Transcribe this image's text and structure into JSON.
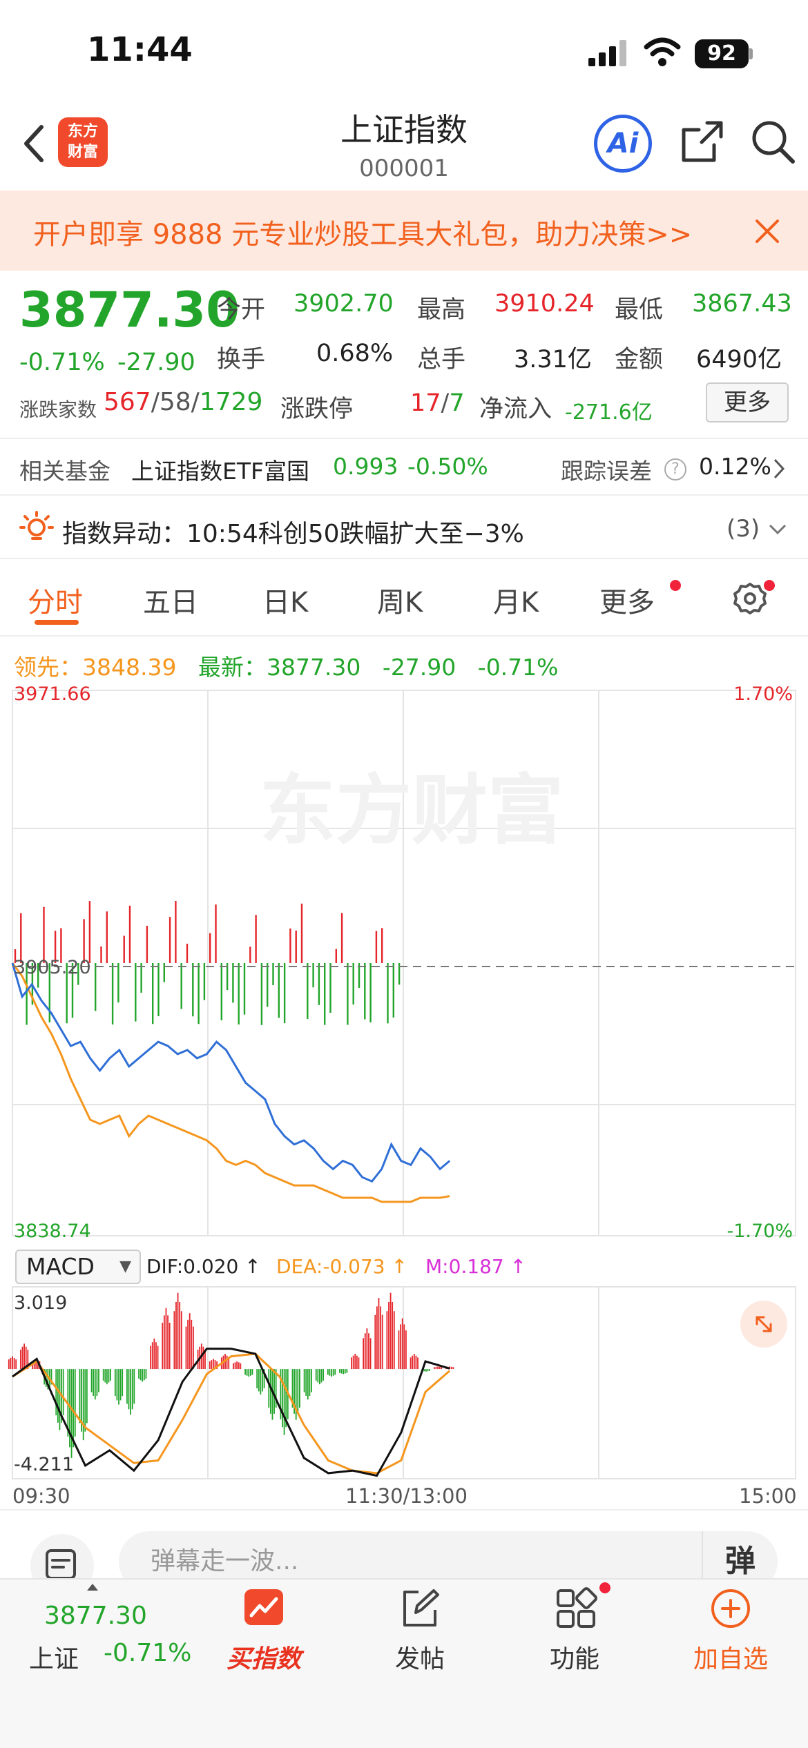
{
  "status_bar": {
    "time": "11:44",
    "battery": "92"
  },
  "header": {
    "title": "上证指数",
    "code": "000001",
    "logo_text": [
      "东方",
      "财富"
    ],
    "ai_label": "Ai"
  },
  "banner": {
    "text": "开户即享 9888 元专业炒股工具大礼包，助力决策>>"
  },
  "quote": {
    "price": "3877.30",
    "change_pct": "-0.71%",
    "change": "-27.90",
    "open_label": "今开",
    "open": "3902.70",
    "high_label": "最高",
    "high": "3910.24",
    "low_label": "最低",
    "low": "3867.43",
    "turnover_label": "换手",
    "turnover": "0.68%",
    "volume_label": "总手",
    "volume": "3.31亿",
    "amount_label": "金额",
    "amount": "6490亿",
    "breadth_label": "涨跌家数",
    "up_count": "567",
    "flat_count": "58",
    "down_count": "1729",
    "limit_label": "涨跌停",
    "limit_up": "17",
    "limit_down": "7",
    "inflow_label": "净流入",
    "inflow": "-271.6亿",
    "more_label": "更多"
  },
  "fund": {
    "label": "相关基金",
    "name": "上证指数ETF富国",
    "price": "0.993",
    "change": "-0.50%",
    "tracking_label": "跟踪误差",
    "tracking_value": "0.12%"
  },
  "alert": {
    "text": "指数异动：10:54科创50跌幅扩大至−3%",
    "count": "(3)"
  },
  "tabs": [
    "分时",
    "五日",
    "日K",
    "周K",
    "月K",
    "更多"
  ],
  "legend": {
    "lead_label": "领先：",
    "lead_value": "3848.39",
    "latest_label": "最新：",
    "latest_value": "3877.30",
    "latest_change": "-27.90",
    "latest_pct": "-0.71%"
  },
  "price_chart": {
    "max": "3971.66",
    "min": "3838.74",
    "max_pct": "1.70%",
    "min_pct": "-1.70%",
    "prev_close": "3905.20",
    "watermark": "东方财富"
  },
  "macd": {
    "selector": "MACD",
    "dif": "DIF:0.020 ↑",
    "dea": "DEA:-0.073 ↑",
    "m": "M:0.187 ↑",
    "max": "3.019",
    "min": "-4.211"
  },
  "time_axis": {
    "start": "09:30",
    "mid": "11:30/13:00",
    "end": "15:00"
  },
  "danmu": {
    "placeholder": "弹幕走一波...",
    "button": "弹"
  },
  "bottom_nav": {
    "index_price": "3877.30",
    "index_name": "上证",
    "index_pct": "-0.71%",
    "buy_label": "买指数",
    "post_label": "发帖",
    "func_label": "功能",
    "add_label": "加自选"
  },
  "colors": {
    "up": "#e5252a",
    "down": "#22a52a",
    "accent": "#f2601e",
    "price_line": "#2f6fd6",
    "avg_line": "#f5961e"
  },
  "chart_data": {
    "type": "line",
    "price_series": [
      3905.2,
      3897,
      3900,
      3896,
      3893,
      3889,
      3885,
      3886,
      3882,
      3879,
      3882,
      3884,
      3880,
      3882,
      3884,
      3886,
      3885,
      3883,
      3884,
      3882,
      3883,
      3886,
      3884,
      3880,
      3876,
      3874,
      3872,
      3866,
      3863,
      3861,
      3862,
      3860,
      3857,
      3855,
      3857,
      3856,
      3853,
      3852,
      3855,
      3861,
      3857,
      3856,
      3860,
      3858,
      3855,
      3857
    ],
    "avg_series": [
      3905.2,
      3902,
      3897,
      3892,
      3888,
      3883,
      3877,
      3872,
      3867,
      3866,
      3867,
      3868,
      3863,
      3866,
      3868,
      3867,
      3866,
      3865,
      3864,
      3863,
      3862,
      3860,
      3857,
      3856,
      3857,
      3856,
      3854,
      3853,
      3852,
      3851,
      3851,
      3851,
      3850,
      3849,
      3848,
      3848,
      3848,
      3848,
      3847,
      3847,
      3847,
      3847,
      3848,
      3848,
      3848,
      3848.39
    ],
    "macd_bars": [
      0.5,
      1.0,
      0.4,
      -0.8,
      -2.4,
      -3.5,
      -2.8,
      -1.2,
      -0.6,
      -1.4,
      -1.8,
      -0.5,
      1.2,
      2.4,
      3.0,
      2.2,
      1.0,
      0.4,
      0.6,
      0.3,
      -0.3,
      -1.0,
      -2.0,
      -2.6,
      -2.0,
      -1.2,
      -0.6,
      -0.3,
      -0.2,
      0.6,
      1.6,
      2.8,
      3.0,
      2.0,
      0.6,
      -0.1,
      0.1,
      0.1
    ],
    "dif_series": [
      -0.3,
      0.4,
      -1.8,
      -3.8,
      -3.2,
      -4.0,
      -2.8,
      -0.5,
      0.8,
      0.8,
      0.6,
      -1.5,
      -3.5,
      -4.1,
      -4.0,
      -4.2,
      -2.5,
      0.3,
      0.02
    ],
    "dea_series": [
      -0.3,
      0.3,
      -1.0,
      -2.3,
      -3.0,
      -3.7,
      -3.6,
      -2.0,
      -0.2,
      0.5,
      0.6,
      -0.3,
      -2.2,
      -3.6,
      -4.0,
      -4.1,
      -3.6,
      -0.9,
      -0.07
    ]
  }
}
